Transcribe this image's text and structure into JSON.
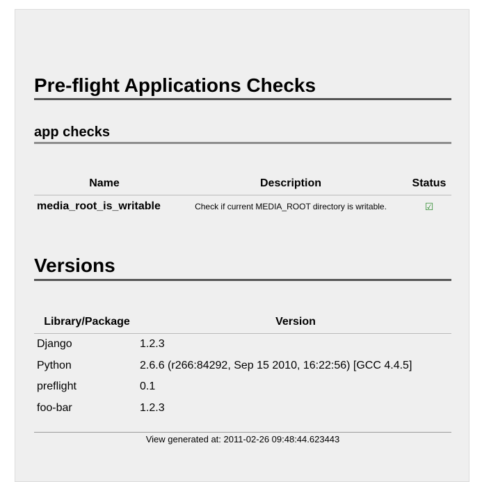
{
  "page": {
    "title": "Pre-flight Applications Checks"
  },
  "app_checks": {
    "heading": "app checks",
    "columns": {
      "name": "Name",
      "description": "Description",
      "status": "Status"
    },
    "rows": [
      {
        "name": "media_root_is_writable",
        "description": "Check if current MEDIA_ROOT directory is writable.",
        "status": "☑",
        "status_icon": "checkbox-checked-icon",
        "status_color": "#2e8b2e"
      }
    ]
  },
  "versions": {
    "heading": "Versions",
    "columns": {
      "library": "Library/Package",
      "version": "Version"
    },
    "rows": [
      {
        "library": "Django",
        "version": "1.2.3"
      },
      {
        "library": "Python",
        "version": "2.6.6 (r266:84292, Sep 15 2010, 16:22:56) [GCC 4.4.5]"
      },
      {
        "library": "preflight",
        "version": "0.1"
      },
      {
        "library": "foo-bar",
        "version": "1.2.3"
      }
    ]
  },
  "footer": {
    "text": "View generated at: 2011-02-26 09:48:44.623443"
  }
}
